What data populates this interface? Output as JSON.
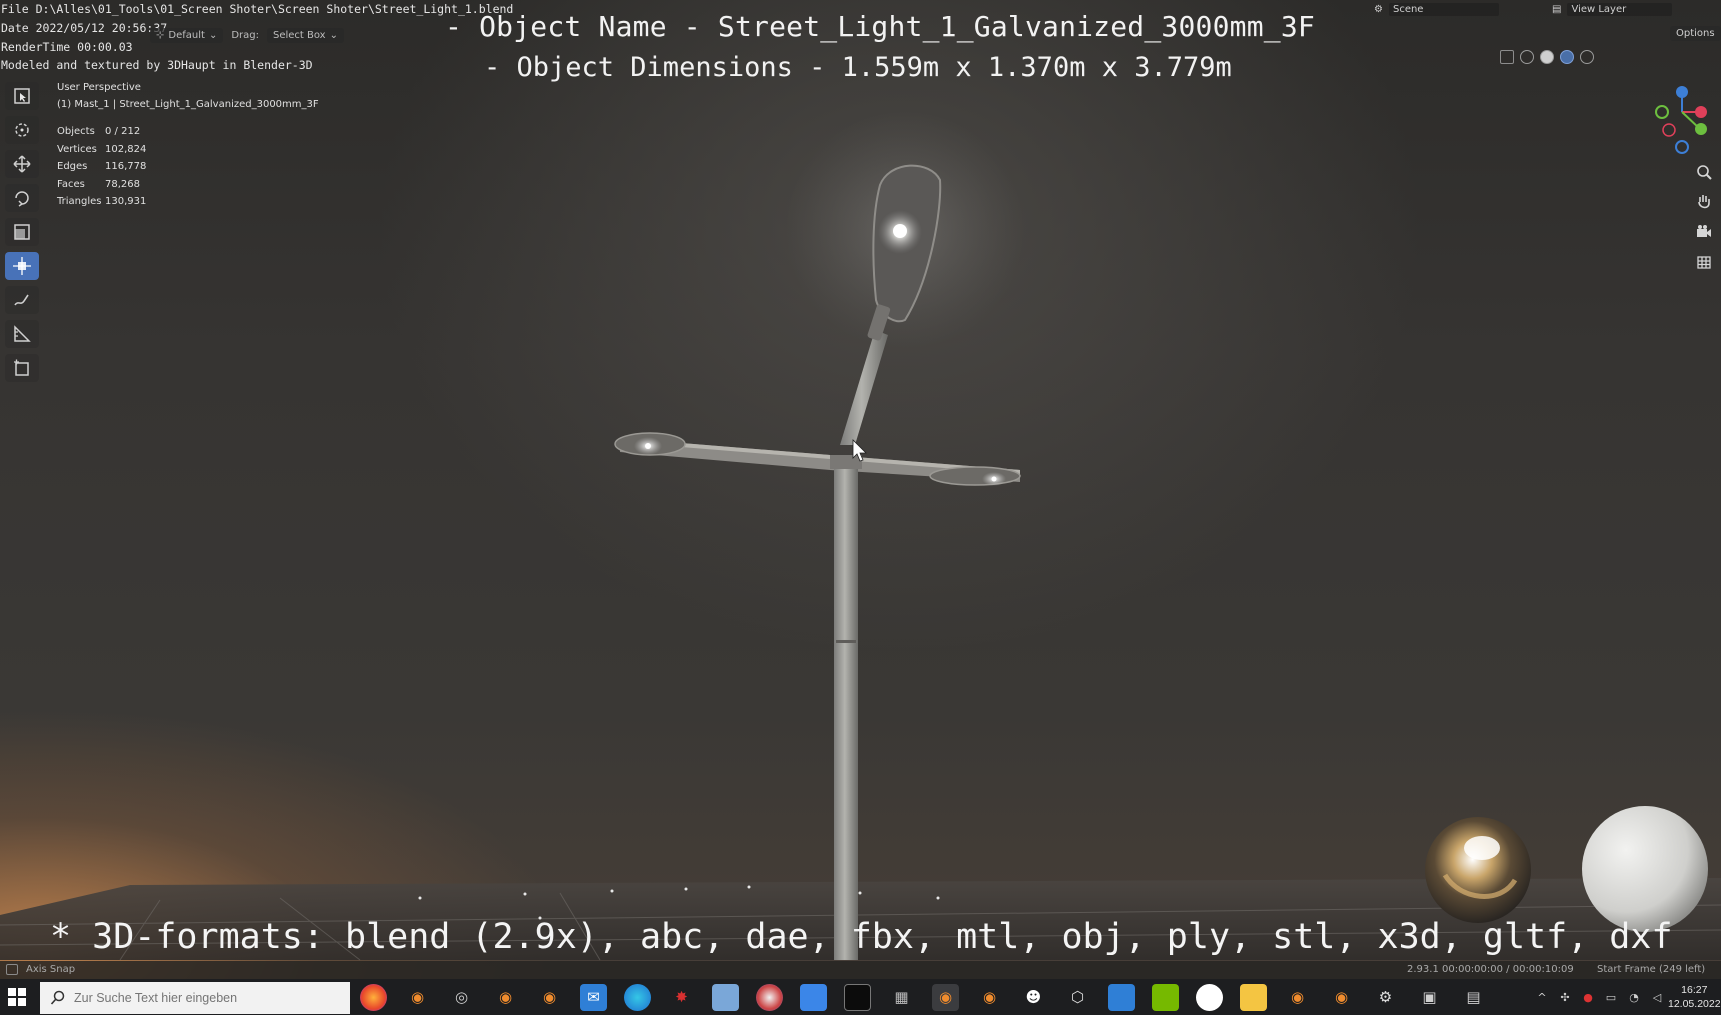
{
  "window": {
    "file_path": "File D:\\Alles\\01_Tools\\01_Screen Shoter\\Screen Shoter\\Street_Light_1.blend",
    "date": "Date 2022/05/12 20:56:37",
    "render_time": "RenderTime 00:00.03",
    "credit": "Modeled and textured by 3DHaupt in Blender-3D"
  },
  "header": {
    "orientation_label": "Default",
    "drag_label": "Drag:",
    "drag_value": "Select Box",
    "scene": "Scene",
    "view_layer": "View Layer",
    "options": "Options"
  },
  "overlay_titles": {
    "object_name": "- Object Name - Street_Light_1_Galvanized_3000mm_3F",
    "object_dimensions": "- Object Dimensions -  1.559m x 1.370m x 3.779m"
  },
  "viewport": {
    "perspective": "User Perspective",
    "active_object": "(1) Mast_1 | Street_Light_1_Galvanized_3000mm_3F",
    "stats": [
      {
        "label": "Objects",
        "value": "0 / 212"
      },
      {
        "label": "Vertices",
        "value": "102,824"
      },
      {
        "label": "Edges",
        "value": "116,778"
      },
      {
        "label": "Faces",
        "value": "78,268"
      },
      {
        "label": "Triangles",
        "value": "130,931"
      }
    ]
  },
  "gizmo": {
    "axes": [
      "X",
      "Y",
      "Z"
    ],
    "colors": {
      "x": "#e0405a",
      "y": "#6dbf3f",
      "z": "#3d7fd6"
    }
  },
  "formats_line": "* 3D-formats: blend (2.9x), abc, dae, fbx, mtl, obj, ply, stl, x3d, gltf, dxf",
  "status_bar": {
    "axis_snap": "Axis Snap",
    "version_info": "2.93.1  00:00:00:00 / 00:00:10:09",
    "start_frame": "Start Frame (249 left)"
  },
  "taskbar": {
    "search_placeholder": "Zur Suche Text hier eingeben",
    "time": "16:27",
    "date": "12.05.2022",
    "icons": [
      "firefox-icon",
      "blender-icon",
      "obs-icon",
      "blender-icon",
      "blender-icon",
      "mail-icon",
      "edge-icon",
      "red-app-icon",
      "notes-icon",
      "paint-icon",
      "store-icon",
      "terminal-icon",
      "gpu-icon",
      "blender-icon",
      "blender-icon",
      "panda-icon",
      "cube-icon",
      "calendar-icon",
      "nvidia-icon",
      "steam-icon",
      "folder-icon",
      "blender-icon",
      "blender-icon",
      "settings-icon",
      "network-icon",
      "file-icon"
    ]
  }
}
